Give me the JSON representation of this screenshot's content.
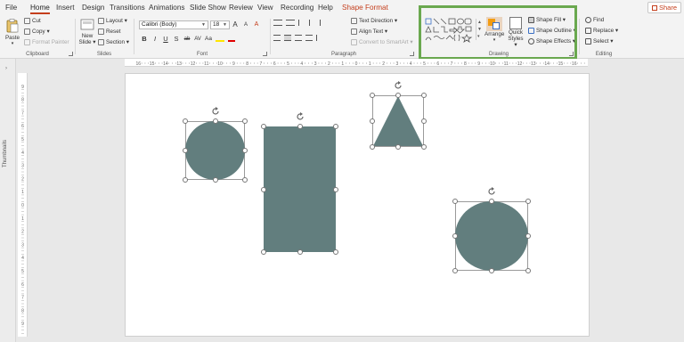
{
  "menu": {
    "tabs": [
      {
        "label": "File"
      },
      {
        "label": "Home"
      },
      {
        "label": "Insert"
      },
      {
        "label": "Design"
      },
      {
        "label": "Transitions"
      },
      {
        "label": "Animations"
      },
      {
        "label": "Slide Show"
      },
      {
        "label": "Review"
      },
      {
        "label": "View"
      },
      {
        "label": "Recording"
      },
      {
        "label": "Help"
      },
      {
        "label": "Shape Format"
      }
    ],
    "active_tab": "Home",
    "share_label": "Share"
  },
  "ribbon": {
    "clipboard": {
      "label": "Clipboard",
      "paste": "Paste",
      "cut": "Cut",
      "copy": "Copy",
      "format_painter": "Format Painter"
    },
    "slides": {
      "label": "Slides",
      "new_slide": "New",
      "new_slide_2": "Slide",
      "layout": "Layout",
      "reset": "Reset",
      "section": "Section"
    },
    "font": {
      "label": "Font",
      "font_name": "Calibri (Body)",
      "font_size": "18",
      "bold": "B",
      "italic": "I",
      "underline": "U",
      "strike": "S",
      "shadow": "ab",
      "spacing": "AV",
      "case": "Aa",
      "grow": "A",
      "shrink": "A",
      "clear": "A"
    },
    "paragraph": {
      "label": "Paragraph",
      "text_direction": "Text Direction",
      "align_text": "Align Text",
      "convert_smartart": "Convert to SmartArt"
    },
    "drawing": {
      "label": "Drawing",
      "arrange": "Arrange",
      "quick_styles": "Quick",
      "quick_styles_2": "Styles",
      "shape_fill": "Shape Fill",
      "shape_outline": "Shape Outline",
      "shape_effects": "Shape Effects"
    },
    "editing": {
      "label": "Editing",
      "find": "Find",
      "replace": "Replace",
      "select": "Select"
    }
  },
  "left_panel": {
    "thumbnails_label": "Thumbnails",
    "expand_icon": "chevron-right-icon"
  },
  "ruler": {
    "h_labels": [
      "16",
      "15",
      "14",
      "13",
      "12",
      "11",
      "10",
      "9",
      "8",
      "7",
      "6",
      "5",
      "4",
      "3",
      "2",
      "1",
      "0",
      "1",
      "2",
      "3",
      "4",
      "5",
      "6",
      "7",
      "8",
      "9",
      "10",
      "11",
      "12",
      "13",
      "14",
      "15",
      "16"
    ],
    "v_labels": [
      "9",
      "8",
      "7",
      "6",
      "5",
      "4",
      "3",
      "2",
      "1",
      "0",
      "1",
      "2",
      "3",
      "4",
      "5",
      "6",
      "7",
      "8",
      "9"
    ]
  },
  "colors": {
    "shape_fill": "#627e7e",
    "accent": "#c43e1c",
    "highlight": "#6aa84f"
  }
}
